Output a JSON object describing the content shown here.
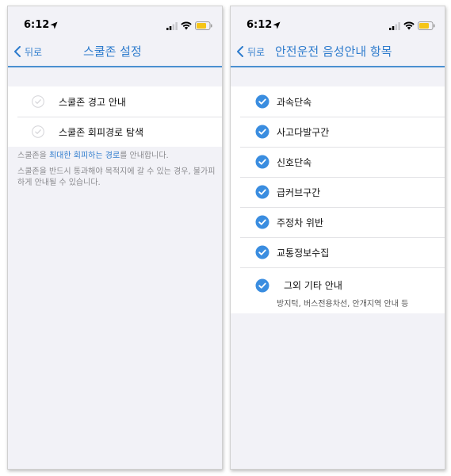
{
  "left_screen": {
    "status_bar": {
      "time": "6:12"
    },
    "nav": {
      "back_label": "뒤로",
      "title": "스쿨존 설정"
    },
    "items": [
      {
        "label": "스쿨존 경고 안내",
        "checked": false
      },
      {
        "label": "스쿨존 회피경로 탐색",
        "checked": false
      }
    ],
    "footer": {
      "line1_prefix": "스쿨존을 ",
      "line1_highlight": "최대한 회피하는 경로",
      "line1_suffix": "를 안내합니다.",
      "line2": "스쿨존을 반드시 통과해야 목적지에 갈 수 있는 경우, 불가피하게 안내될 수 있습니다."
    }
  },
  "right_screen": {
    "status_bar": {
      "time": "6:12"
    },
    "nav": {
      "back_label": "뒤로",
      "title": "안전운전 음성안내 항목"
    },
    "items": [
      {
        "label": "과속단속",
        "checked": true
      },
      {
        "label": "사고다발구간",
        "checked": true
      },
      {
        "label": "신호단속",
        "checked": true
      },
      {
        "label": "급커브구간",
        "checked": true
      },
      {
        "label": "주정차 위반",
        "checked": true
      },
      {
        "label": "교통정보수집",
        "checked": true
      },
      {
        "label": "그외 기타 안내",
        "sublabel": "방지턱, 버스전용차선, 안개지역 안내 등",
        "checked": true
      }
    ]
  },
  "colors": {
    "accent": "#2f7ccd",
    "check_fill": "#3a8de0",
    "background": "#f2f2f7"
  },
  "icons": [
    "location-arrow-icon",
    "cellular-signal-icon",
    "wifi-icon",
    "battery-icon",
    "chevron-left-icon",
    "checkmark-empty-icon",
    "checkmark-filled-icon"
  ]
}
